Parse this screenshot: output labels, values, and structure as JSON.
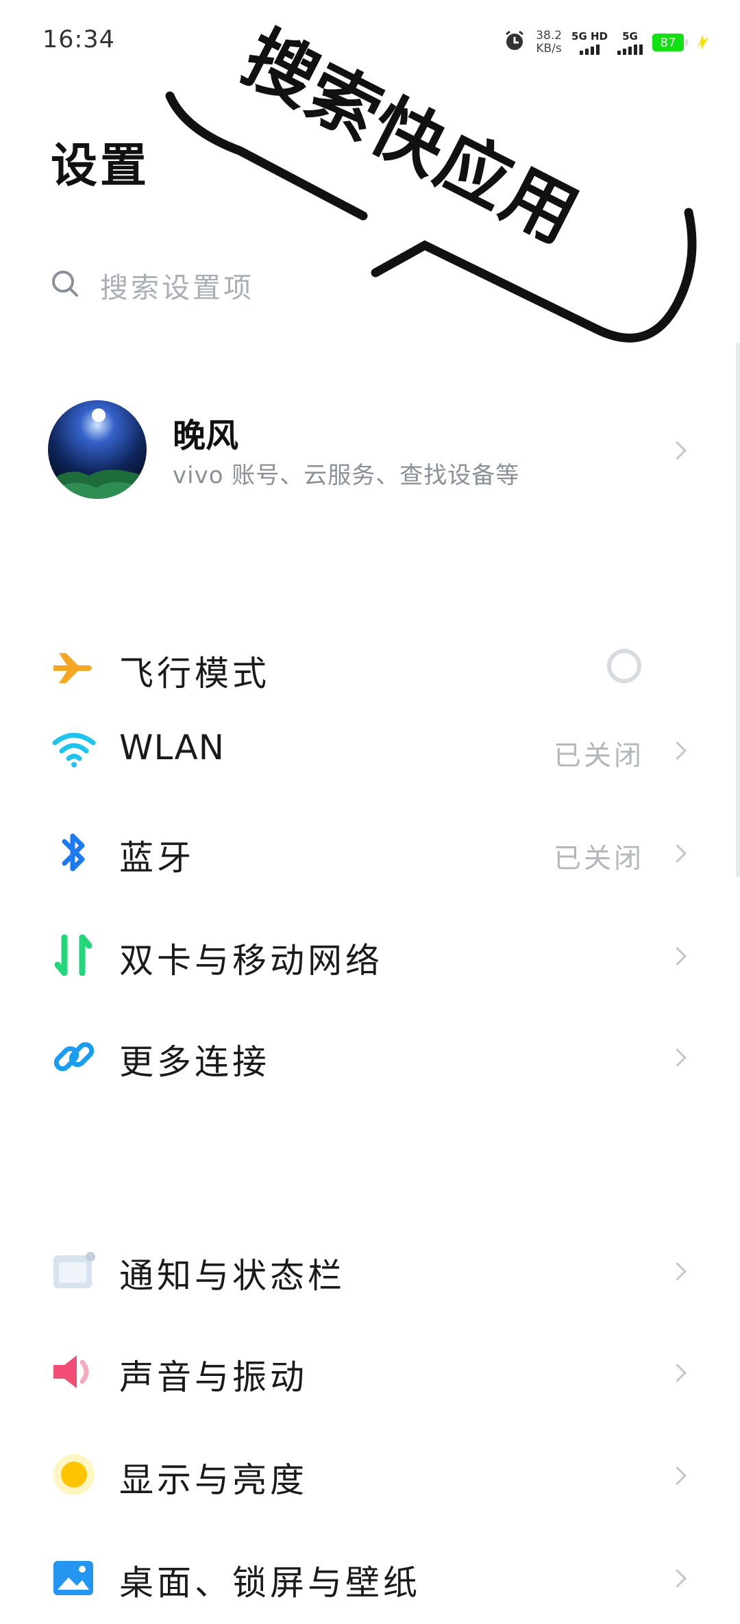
{
  "status_bar": {
    "time": "16:34",
    "net_speed_value": "38.2",
    "net_speed_unit": "KB/s",
    "sim1_label": "5G HD",
    "sim2_label": "5G",
    "battery": "87",
    "icons": [
      "alarm-icon",
      "signal-icon",
      "battery-icon",
      "charging-icon"
    ]
  },
  "overlay": {
    "text": "搜索快应用"
  },
  "header": {
    "title": "设置"
  },
  "search": {
    "placeholder": "搜索设置项"
  },
  "account": {
    "name": "晚风",
    "subtitle": "vivo 账号、云服务、查找设备等"
  },
  "connectivity": [
    {
      "label": "飞行模式",
      "icon": "airplane-icon",
      "value": ""
    },
    {
      "label": "WLAN",
      "icon": "wifi-icon",
      "value": "已关闭"
    },
    {
      "label": "蓝牙",
      "icon": "bluetooth-icon",
      "value": "已关闭"
    },
    {
      "label": "双卡与移动网络",
      "icon": "mobile-data-icon",
      "value": ""
    },
    {
      "label": "更多连接",
      "icon": "link-icon",
      "value": ""
    }
  ],
  "device": [
    {
      "label": "通知与状态栏",
      "icon": "notification-icon"
    },
    {
      "label": "声音与振动",
      "icon": "speaker-icon"
    },
    {
      "label": "显示与亮度",
      "icon": "brightness-icon"
    },
    {
      "label": "桌面、锁屏与壁纸",
      "icon": "wallpaper-icon"
    }
  ],
  "colors": {
    "airplane": "#f5a623",
    "wifi": "#1ec3ee",
    "bluetooth": "#1e7af0",
    "mobile": "#23d67a",
    "link": "#1a9cf0",
    "notification": "#d7e3ee",
    "speaker": "#f24d74",
    "brightness": "#ffc400",
    "wallpaper": "#2495f0",
    "battery": "#12e012"
  }
}
